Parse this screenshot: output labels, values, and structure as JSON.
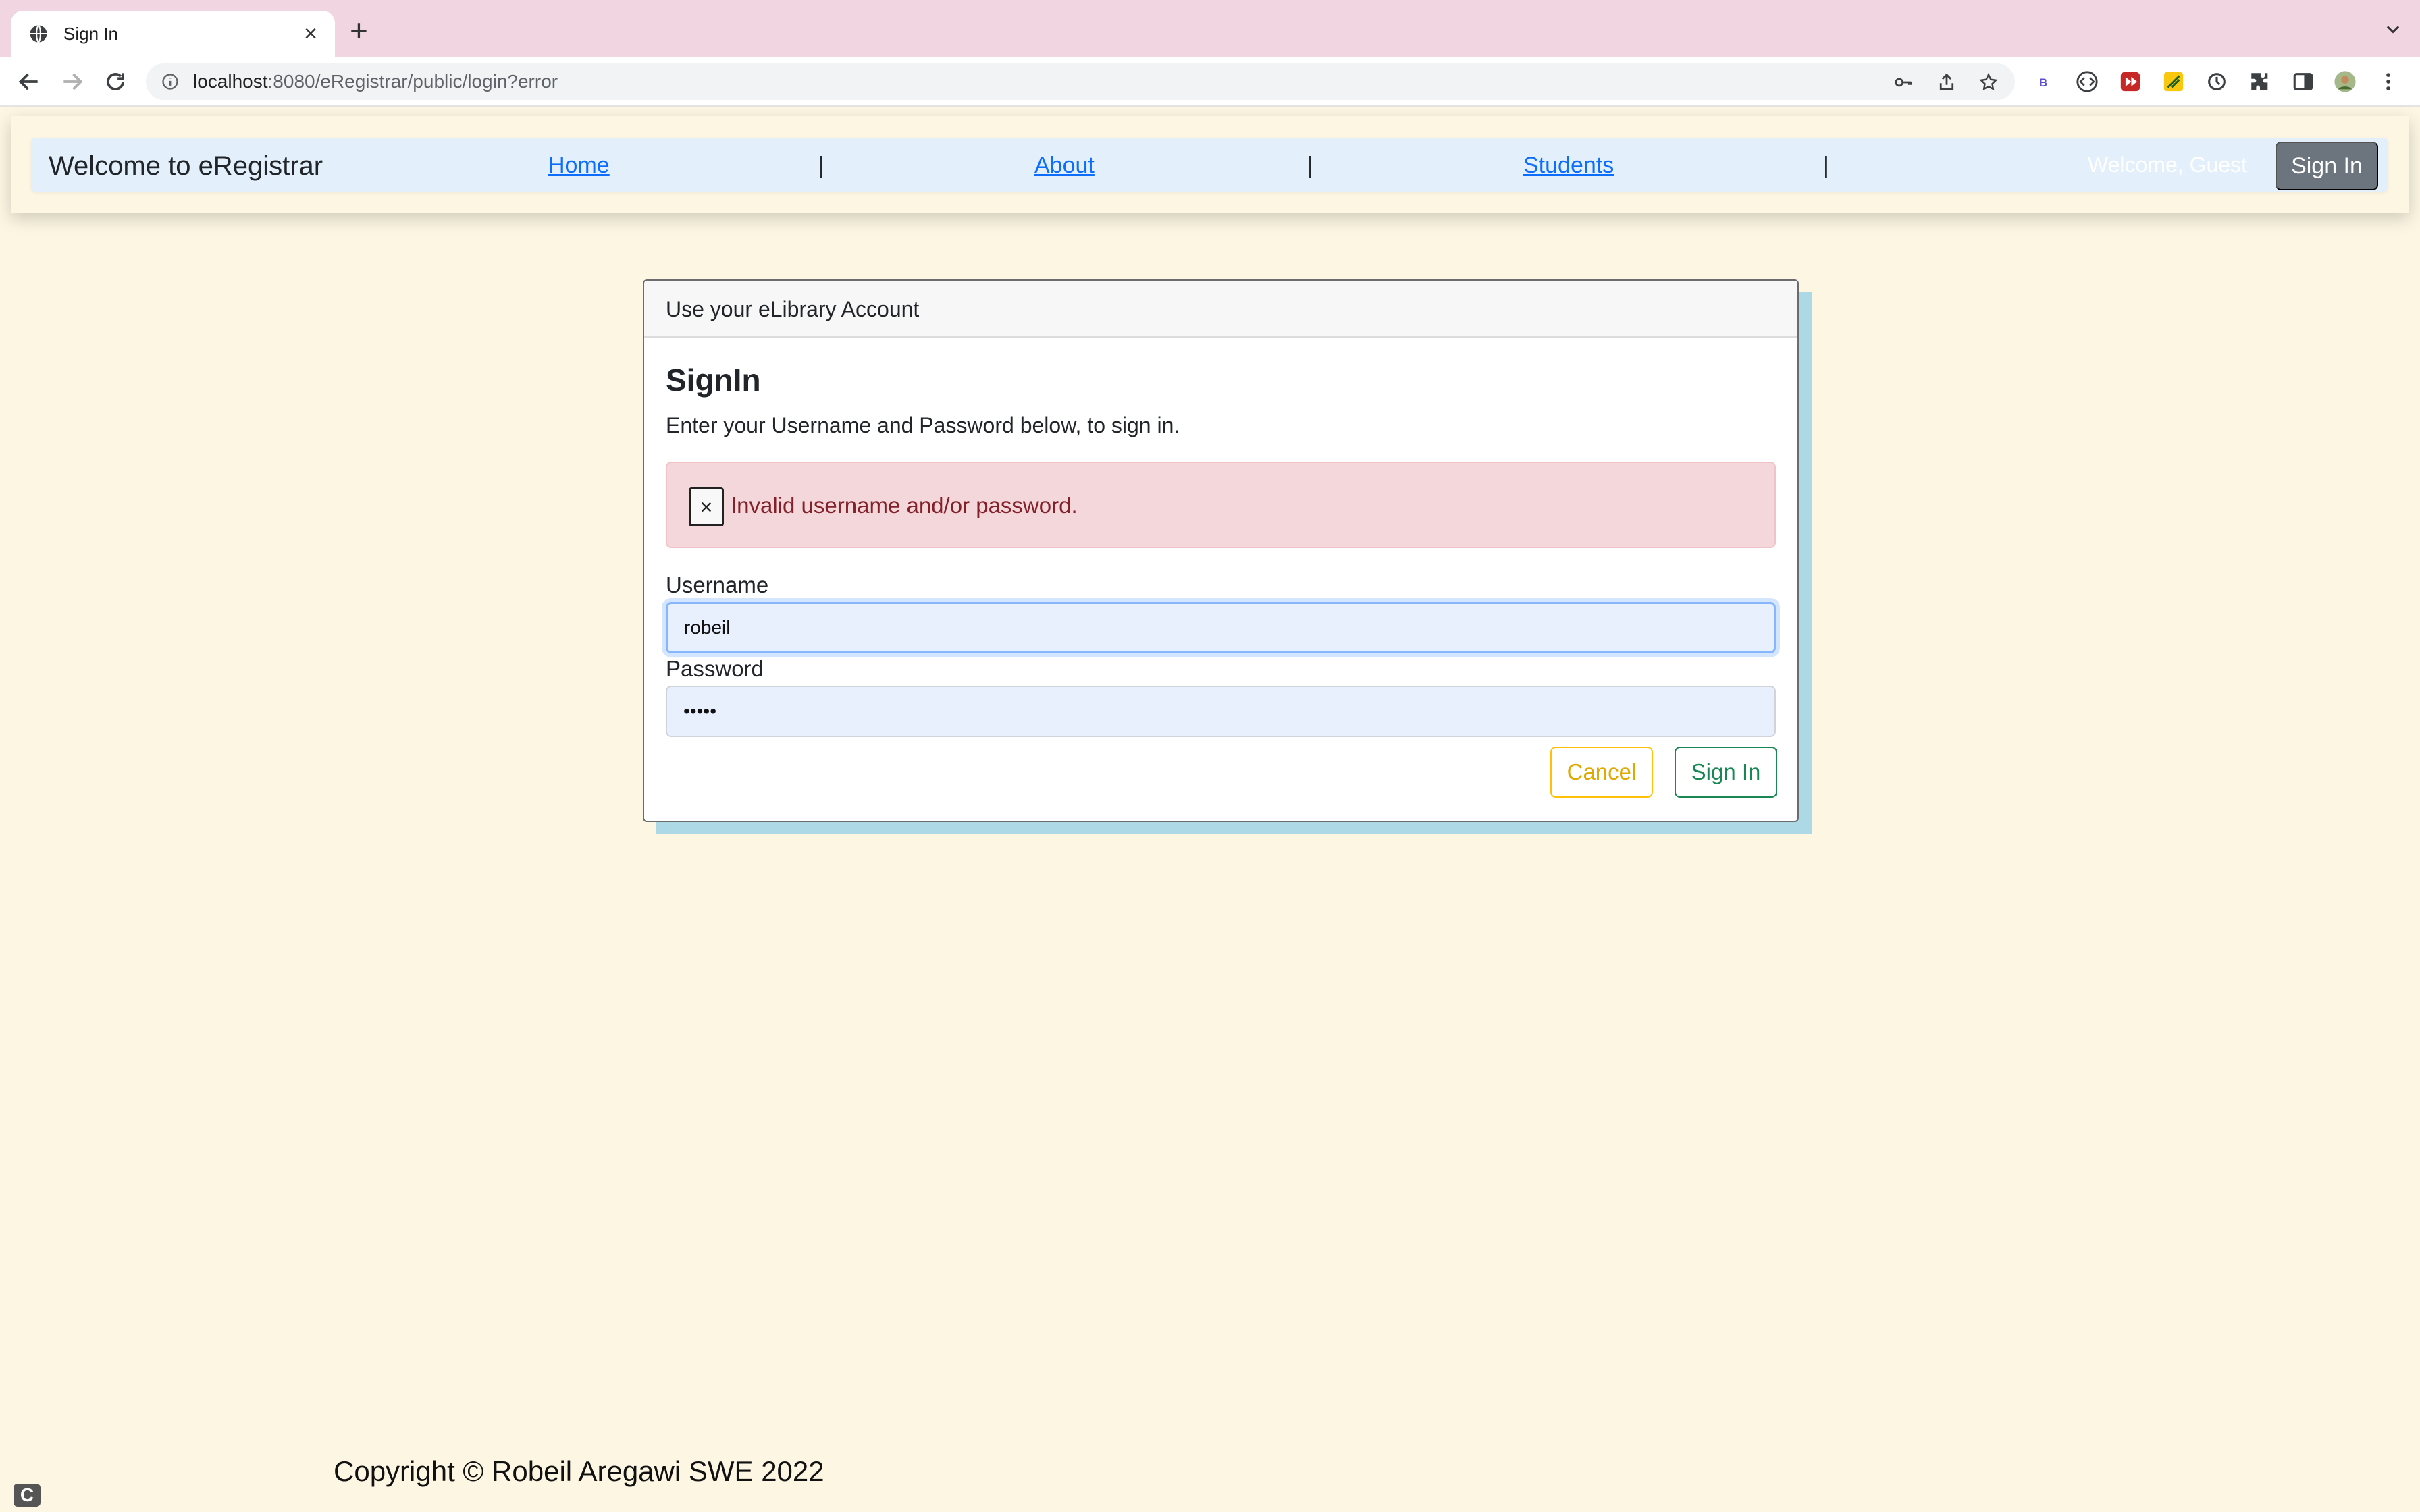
{
  "browser": {
    "tab_title": "Sign In",
    "url_host": "localhost",
    "url_rest": ":8080/eRegistrar/public/login?error"
  },
  "navbar": {
    "brand": "Welcome to eRegistrar",
    "links": [
      "Home",
      "About",
      "Students"
    ],
    "separator": "|",
    "welcome": "Welcome, Guest",
    "signin_label": "Sign In"
  },
  "card": {
    "header": "Use your eLibrary Account",
    "title": "SignIn",
    "subtitle": "Enter your Username and Password below, to sign in.",
    "alert_close": "×",
    "alert_message": "Invalid username and/or password.",
    "username_label": "Username",
    "username_value": "robeil",
    "password_label": "Password",
    "password_value": "•••••",
    "cancel_label": "Cancel",
    "signin_label": "Sign In"
  },
  "footer": {
    "copyright": "Copyright © Robeil Aregawi SWE 2022"
  },
  "colors": {
    "page_bg": "#fdf6e3",
    "navbar_bg": "#e3f0fb",
    "alert_bg": "#f3d7db",
    "alert_text": "#842029",
    "card_shadow": "#add8e6",
    "link": "#0d6efd",
    "cancel": "#ffc107",
    "signin": "#198754"
  }
}
